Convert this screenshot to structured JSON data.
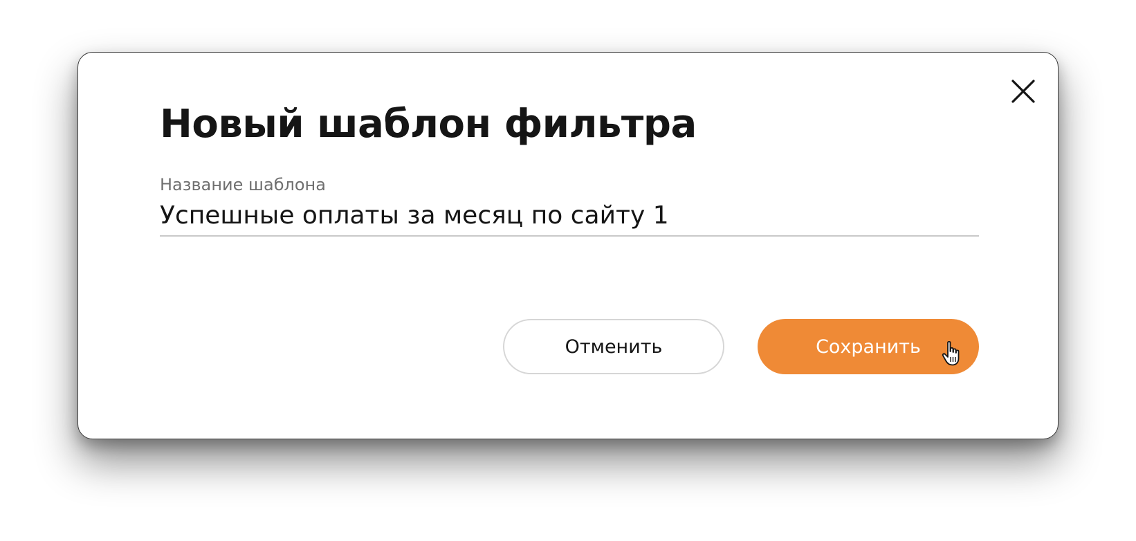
{
  "dialog": {
    "title": "Новый шаблон фильтра",
    "close_icon": "close-icon",
    "field": {
      "label": "Название шаблона",
      "value": "Успешные оплаты за месяц по сайту 1"
    },
    "buttons": {
      "cancel_label": "Отменить",
      "save_label": "Сохранить"
    }
  },
  "pointer": {
    "icon": "hand-pointer-icon"
  },
  "colors": {
    "accent": "#ef8a36",
    "text": "#151515",
    "label": "#6f6f6f",
    "divider": "#c9c9c9"
  }
}
